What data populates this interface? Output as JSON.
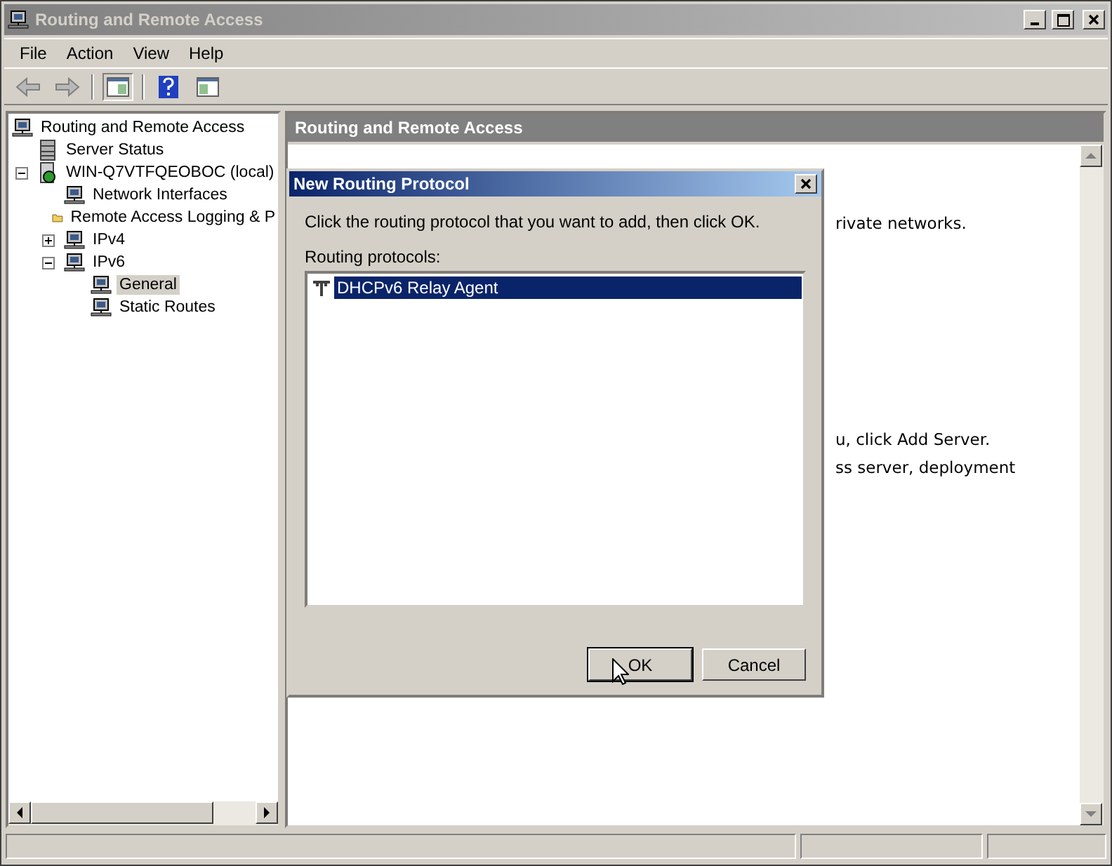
{
  "window": {
    "title": "Routing and Remote Access"
  },
  "menu": [
    "File",
    "Action",
    "View",
    "Help"
  ],
  "tree": [
    {
      "label": "Routing and Remote Access",
      "kind": "computer",
      "selected": false,
      "children": [
        {
          "label": "Server Status",
          "kind": "server",
          "selected": false
        },
        {
          "label": "WIN-Q7VTFQEOBOC (local)",
          "kind": "host",
          "selected": false,
          "expanded": true,
          "children": [
            {
              "label": "Network Interfaces",
              "kind": "computer",
              "selected": false
            },
            {
              "label": "Remote Access Logging & P",
              "kind": "folder",
              "selected": false
            },
            {
              "label": "IPv4",
              "kind": "computer",
              "selected": false,
              "expanded": false
            },
            {
              "label": "IPv6",
              "kind": "computer",
              "selected": false,
              "expanded": true,
              "children": [
                {
                  "label": "General",
                  "kind": "computer",
                  "selected": true
                },
                {
                  "label": "Static Routes",
                  "kind": "computer",
                  "selected": false
                }
              ]
            }
          ]
        }
      ]
    }
  ],
  "pane": {
    "title": "Routing and Remote Access",
    "lines": [
      "rivate networks.",
      "u, click Add Server.",
      "ss server, deployment"
    ]
  },
  "dialog": {
    "title": "New Routing Protocol",
    "instruction": "Click the routing protocol that you want to add, then click OK.",
    "list_label": "Routing protocols:",
    "protocols": [
      {
        "label": "DHCPv6 Relay Agent",
        "selected": true
      }
    ],
    "buttons": [
      {
        "label": "OK",
        "default": true
      },
      {
        "label": "Cancel",
        "default": false
      }
    ]
  }
}
